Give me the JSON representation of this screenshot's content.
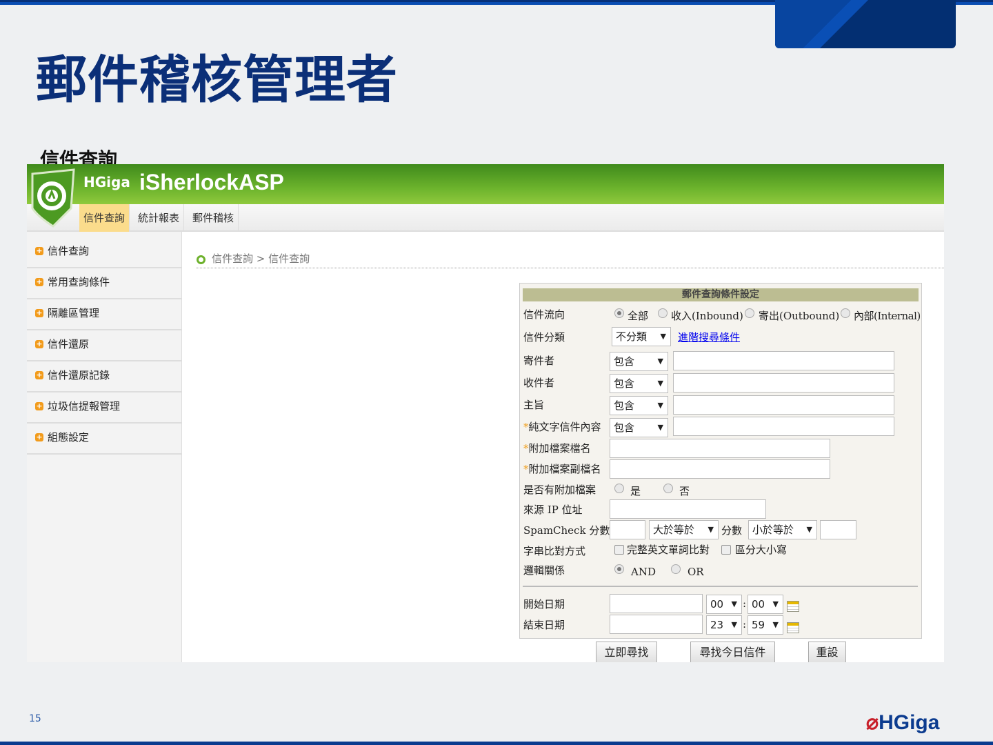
{
  "slide": {
    "title": "郵件稽核管理者",
    "subtitle": "信件查詢",
    "page_number": "15",
    "footer_logo": "HGiga"
  },
  "app": {
    "brand_company": "HGiga",
    "brand_product": "iSherlockASP",
    "tabs": [
      {
        "label": "信件查詢",
        "active": true
      },
      {
        "label": "統計報表"
      },
      {
        "label": "郵件稽核"
      }
    ],
    "sidebar": [
      {
        "label": "信件查詢"
      },
      {
        "label": "常用查詢條件"
      },
      {
        "label": "隔離區管理"
      },
      {
        "label": "信件還原"
      },
      {
        "label": "信件還原記錄"
      },
      {
        "label": "垃圾信提報管理"
      },
      {
        "label": "組態設定"
      }
    ],
    "breadcrumb": "信件查詢 > 信件查詢",
    "form": {
      "title": "郵件查詢條件設定",
      "direction": {
        "label": "信件流向",
        "options": [
          "全部",
          "收入(Inbound)",
          "寄出(Outbound)",
          "內部(Internal)"
        ],
        "selected": "全部"
      },
      "category": {
        "label": "信件分類",
        "value": "不分類",
        "advanced_link": "進階搜尋條件"
      },
      "sender": {
        "label": "寄件者",
        "op": "包含",
        "value": ""
      },
      "recipient": {
        "label": "收件者",
        "op": "包含",
        "value": ""
      },
      "subject": {
        "label": "主旨",
        "op": "包含",
        "value": ""
      },
      "body": {
        "label": "純文字信件內容",
        "op": "包含",
        "value": "",
        "star": "*"
      },
      "attach_name": {
        "label": "附加檔案檔名",
        "value": "",
        "star": "*"
      },
      "attach_ext": {
        "label": "附加檔案副檔名",
        "value": "",
        "star": "*"
      },
      "has_attach": {
        "label": "是否有附加檔案",
        "options": [
          "是",
          "否"
        ]
      },
      "source_ip": {
        "label": "來源 IP 位址",
        "value": ""
      },
      "spam": {
        "label": "SpamCheck 分數",
        "op1": "大於等於",
        "mid": "分數",
        "op2": "小於等於"
      },
      "match": {
        "label": "字串比對方式",
        "options": [
          "完整英文單詞比對",
          "區分大小寫"
        ]
      },
      "logic": {
        "label": "邏輯關係",
        "options": [
          "AND",
          "OR"
        ],
        "selected": "AND"
      },
      "start": {
        "label": "開始日期",
        "hour": "00",
        "minute": "00"
      },
      "end": {
        "label": "結束日期",
        "hour": "23",
        "minute": "59"
      },
      "colon": ":",
      "buttons": {
        "search": "立即尋找",
        "today": "尋找今日信件",
        "reset": "重設"
      }
    }
  }
}
